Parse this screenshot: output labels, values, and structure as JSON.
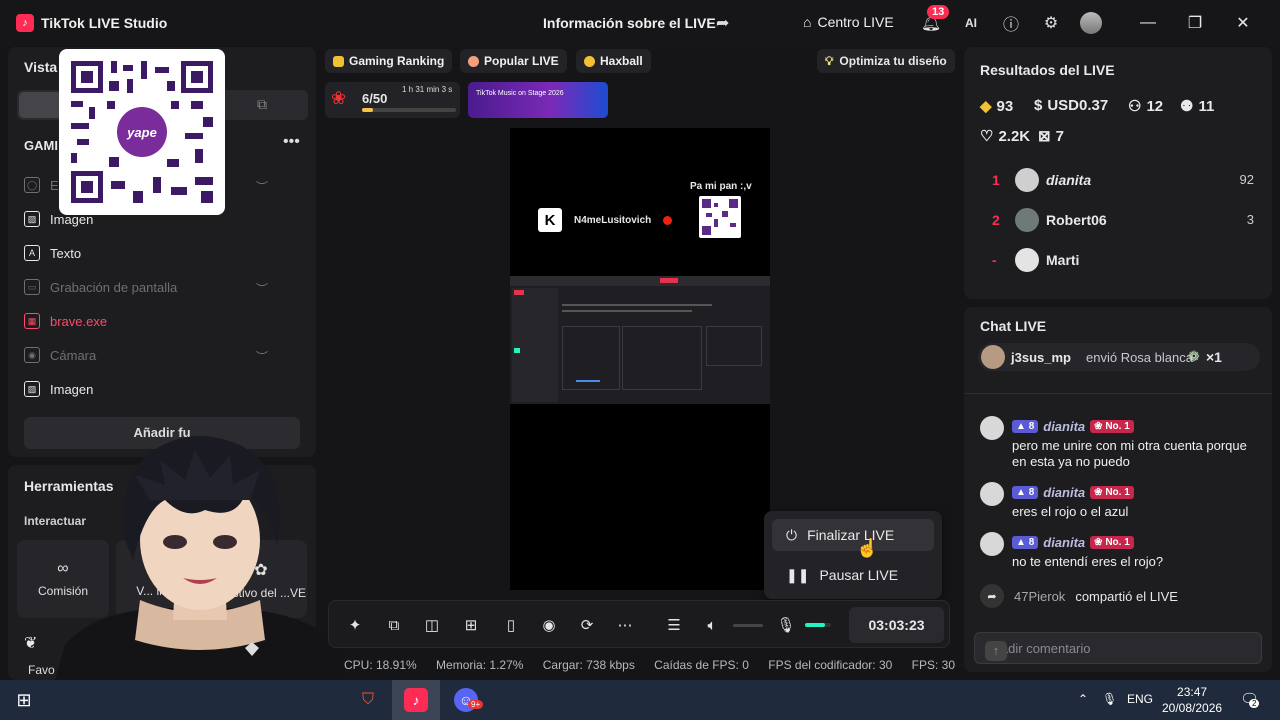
{
  "titlebar": {
    "app_name": "TikTok LIVE Studio",
    "live_info": "Información sobre el LIVE",
    "centro_live": "Centro LIVE",
    "notification_count": "13"
  },
  "left": {
    "vista": "Vista",
    "scene_title": "GAMI",
    "sources": [
      {
        "label": "E",
        "state": "dim"
      },
      {
        "label": "Imagen",
        "state": "normal"
      },
      {
        "label": "Texto",
        "state": "normal"
      },
      {
        "label": "Grabación de pantalla",
        "state": "dim"
      },
      {
        "label": "brave.exe",
        "state": "red"
      },
      {
        "label": "Cámara",
        "state": "dim"
      },
      {
        "label": "Imagen",
        "state": "normal"
      }
    ],
    "add_source": "Añadir fu",
    "tools_title": "Herramientas",
    "interact": "Interactuar",
    "tools": [
      {
        "label": "Comisión"
      },
      {
        "label": "V... invit..."
      },
      {
        "label": "...estivo del ...VE"
      }
    ],
    "favorites_label": "Favo",
    "qr_brand": "yape"
  },
  "center": {
    "chips": [
      {
        "label": "Gaming Ranking",
        "color": "#f2c033"
      },
      {
        "label": "Popular LIVE",
        "color": "#f5a07a"
      },
      {
        "label": "Haxball",
        "color": "#f2c033"
      }
    ],
    "optimize": "Optimiza tu diseño",
    "goal": {
      "count": "6/50",
      "time": "1 h 31 min 3 s",
      "progress": 0.12
    },
    "banner": "TikTok Music on Stage 2026",
    "preview": {
      "streamer": "N4meLusitovich",
      "caption": "Pa mi pan :,v"
    },
    "popup": {
      "end": "Finalizar LIVE",
      "pause": "Pausar LIVE"
    },
    "timer": "03:03:23",
    "stats": {
      "cpu": "CPU: 18.91%",
      "mem": "Memoria: 1.27%",
      "load": "Cargar: 738 kbps",
      "drops": "Caídas de FPS: 0",
      "enc": "FPS del codificador: 30",
      "fps": "FPS: 30"
    }
  },
  "results": {
    "title": "Resultados del LIVE",
    "diamonds": "93",
    "usd": "USD0.37",
    "viewers": "12",
    "new_followers": "11",
    "likes": "2.2K",
    "gifts": "7",
    "ranking": [
      {
        "pos": "1",
        "name": "dianita",
        "score": "92"
      },
      {
        "pos": "2",
        "name": "Robert06",
        "score": "3"
      },
      {
        "pos": "-",
        "name": "Marti",
        "score": ""
      }
    ]
  },
  "chat": {
    "title": "Chat LIVE",
    "gift": {
      "user": "j3sus_mp",
      "text": "envió Rosa blanca",
      "mult": "×1"
    },
    "messages": [
      {
        "level": "8",
        "user": "dianita",
        "badge": "No. 1",
        "text": "pero me unire con mi otra cuenta porque en esta ya no puedo"
      },
      {
        "level": "8",
        "user": "dianita",
        "badge": "No. 1",
        "text": "eres el rojo o el azul"
      },
      {
        "level": "8",
        "user": "dianita",
        "badge": "No. 1",
        "text": "no te entendí eres el rojo?"
      }
    ],
    "share": {
      "user": "47Pierok",
      "text": "compartió el LIVE"
    },
    "placeholder": "Añadir comentario"
  },
  "taskbar": {
    "lang": "ENG",
    "time": "23:47",
    "date": "20/08/2026",
    "notif": "2",
    "discord_badge": "9+"
  }
}
